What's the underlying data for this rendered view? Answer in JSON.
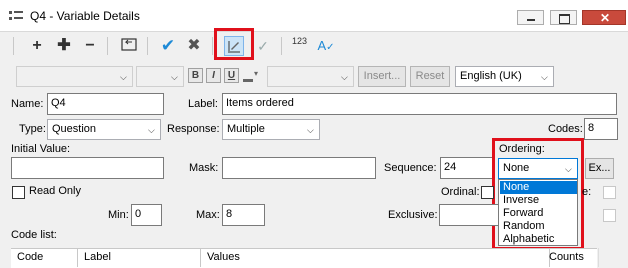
{
  "window": {
    "title": "Q4 - Variable Details",
    "controls": {
      "minimize": "minimize",
      "maximize": "maximize",
      "close": "close"
    }
  },
  "toolbar": {
    "icons": [
      "add-icon",
      "add-multiple-icon",
      "remove-icon",
      "back-icon",
      "confirm-icon",
      "cancel-icon",
      "edit-ordering-icon",
      "check-icon",
      "numbering-icon",
      "spellcheck-icon"
    ],
    "numbering_label": "123"
  },
  "format_bar": {
    "bold": "B",
    "italic": "I",
    "underline": "U",
    "insert_label": "Insert...",
    "reset_label": "Reset",
    "language_value": "English (UK)"
  },
  "form": {
    "name_label": "Name:",
    "name_value": "Q4",
    "label_label": "Label:",
    "label_value": "Items ordered",
    "type_label": "Type:",
    "type_value": "Question",
    "response_label": "Response:",
    "response_value": "Multiple",
    "codes_label": "Codes:",
    "codes_value": "8",
    "initial_value_label": "Initial Value:",
    "mask_label": "Mask:",
    "sequence_label": "Sequence:",
    "sequence_value": "24",
    "ordering_label": "Ordering:",
    "ordering_value": "None",
    "ex_button": "Ex...",
    "read_only_label": "Read Only",
    "ordinal_label": "Ordinal:",
    "e_label": "e:",
    "min_label": "Min:",
    "min_value": "0",
    "max_label": "Max:",
    "max_value": "8",
    "exclusive_label": "Exclusive:",
    "code_list_label": "Code list:"
  },
  "ordering_options": [
    "None",
    "Inverse",
    "Forward",
    "Random",
    "Alphabetic"
  ],
  "ordering_selected_index": 0,
  "grid": {
    "columns": [
      "Code",
      "Label",
      "Values",
      "Counts"
    ]
  },
  "colors": {
    "highlight": "#e0101b",
    "selection": "#0078d7",
    "accent_blue": "#1e8ad6"
  }
}
